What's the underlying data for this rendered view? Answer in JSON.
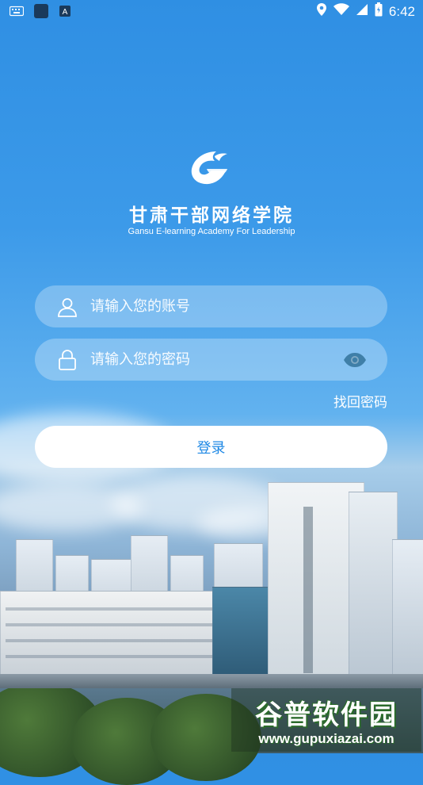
{
  "status_bar": {
    "time": "6:42"
  },
  "brand": {
    "title": "甘肃干部网络学院",
    "subtitle": "Gansu E-learning Academy For Leadership"
  },
  "form": {
    "account_placeholder": "请输入您的账号",
    "password_placeholder": "请输入您的密码",
    "forgot_label": "找回密码",
    "login_label": "登录"
  },
  "icons": {
    "account": "user-icon",
    "password": "lock-icon",
    "toggle": "eye-icon"
  },
  "watermark": {
    "main": "谷普软件园",
    "url": "www.gupuxiazai.com"
  },
  "colors": {
    "accent": "#1e88e5",
    "sky": "#3c9ae9"
  }
}
